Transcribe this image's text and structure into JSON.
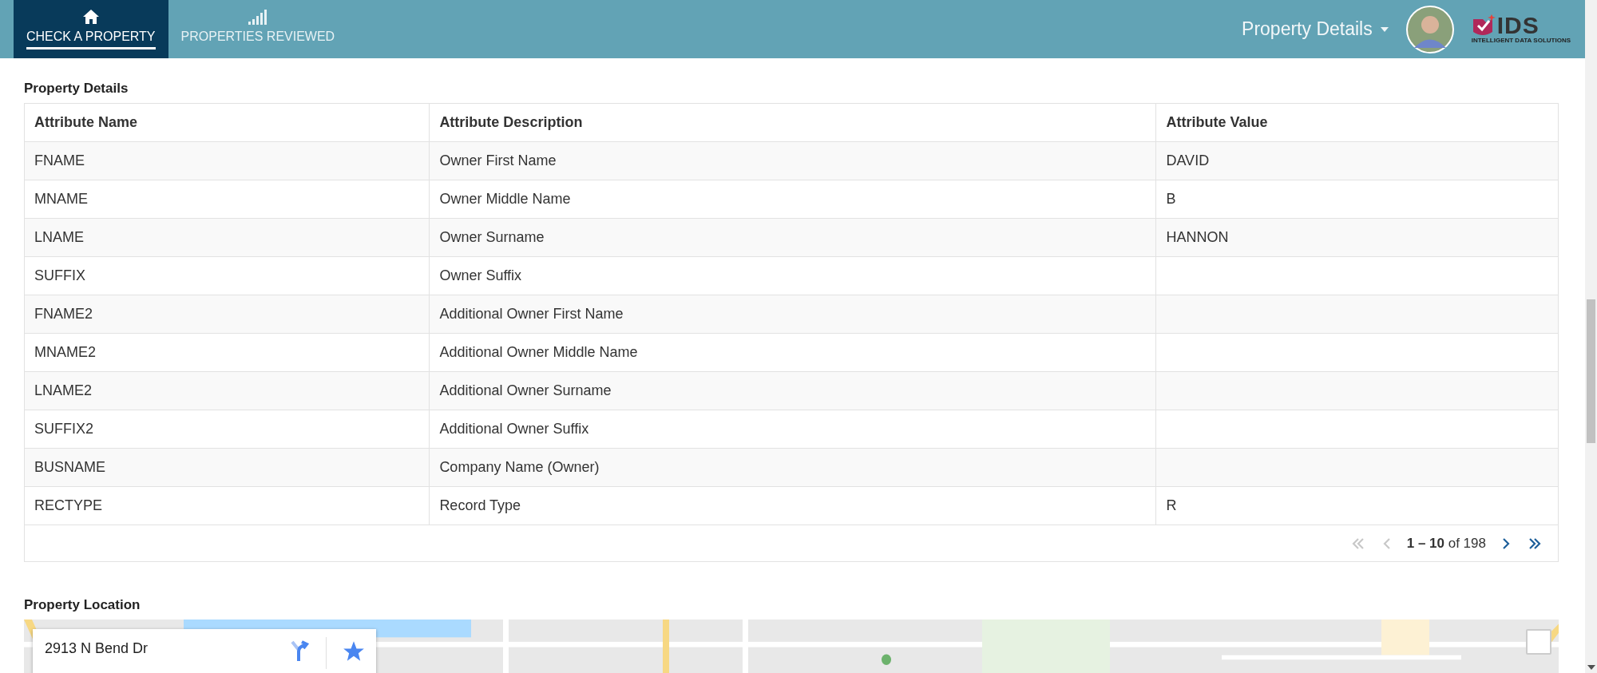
{
  "nav": {
    "tabs": [
      {
        "label": "CHECK A PROPERTY",
        "selected": true
      },
      {
        "label": "PROPERTIES REVIEWED",
        "selected": false
      }
    ],
    "page_menu": {
      "label": "Property Details"
    },
    "logo": {
      "name": "IDS",
      "tagline": "INTELLIGENT DATA SOLUTIONS"
    }
  },
  "details": {
    "title": "Property Details",
    "columns": [
      "Attribute Name",
      "Attribute Description",
      "Attribute Value"
    ],
    "rows": [
      [
        "FNAME",
        "Owner First Name",
        "DAVID"
      ],
      [
        "MNAME",
        "Owner Middle Name",
        "B"
      ],
      [
        "LNAME",
        "Owner Surname",
        "HANNON"
      ],
      [
        "SUFFIX",
        "Owner Suffix",
        ""
      ],
      [
        "FNAME2",
        "Additional Owner First Name",
        ""
      ],
      [
        "MNAME2",
        "Additional Owner Middle Name",
        ""
      ],
      [
        "LNAME2",
        "Additional Owner Surname",
        ""
      ],
      [
        "SUFFIX2",
        "Additional Owner Suffix",
        ""
      ],
      [
        "BUSNAME",
        "Company Name (Owner)",
        ""
      ],
      [
        "RECTYPE",
        "Record Type",
        "R"
      ]
    ],
    "pagination": {
      "range": "**1 – 10** of 198",
      "first": {
        "disabled": true
      },
      "previous": {
        "disabled": true
      },
      "next": {
        "disabled": false
      },
      "last": {
        "disabled": false
      }
    }
  },
  "location": {
    "title": "Property Location",
    "map": {
      "address": "2913 N Bend Dr"
    }
  }
}
